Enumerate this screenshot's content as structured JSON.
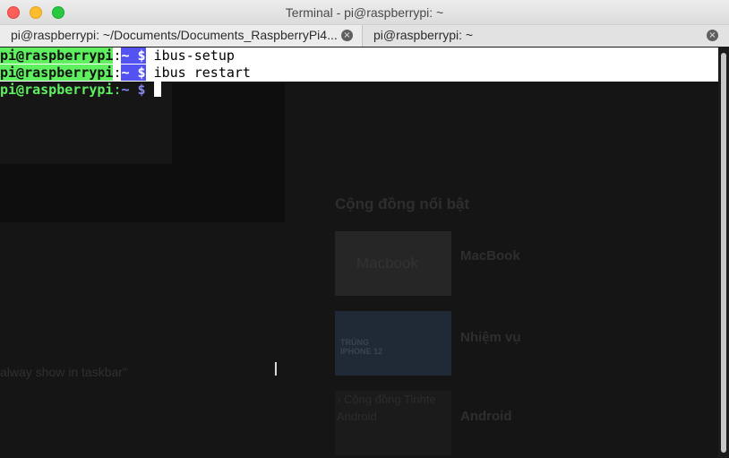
{
  "window": {
    "title": "Terminal - pi@raspberrypi: ~"
  },
  "tabs": [
    {
      "label": "pi@raspberrypi: ~/Documents/Documents_RaspberryPi4...",
      "close_icon": "×"
    },
    {
      "label": "pi@raspberrypi: ~",
      "close_icon": "×"
    }
  ],
  "terminal": {
    "lines": [
      {
        "user": "pi@raspberrypi",
        "colon": ":",
        "path": "~ $",
        "command": " ibus-setup"
      },
      {
        "user": "pi@raspberrypi",
        "colon": ":",
        "path": "~ $",
        "command": " ibus restart"
      },
      {
        "user": "pi@raspberrypi",
        "colon": ":",
        "path": "~ $",
        "command": " "
      }
    ]
  },
  "background_page": {
    "heading": "Cộng đồng nổi bật",
    "items": [
      "MacBook",
      "Nhiệm vụ",
      "Android"
    ],
    "side_text": "alway show in taskbar\"",
    "caption_1": "› Cộng đồng Tinhte",
    "caption_2": "Android",
    "thumb_1_text": "Macbook",
    "thumb_2_text": "TRÚNG IPHONE 12"
  },
  "colors": {
    "user_highlight": "#5ff05f",
    "path_highlight": "#5353f3",
    "selection": "#ffffff",
    "terminal_bg": "#151515"
  }
}
